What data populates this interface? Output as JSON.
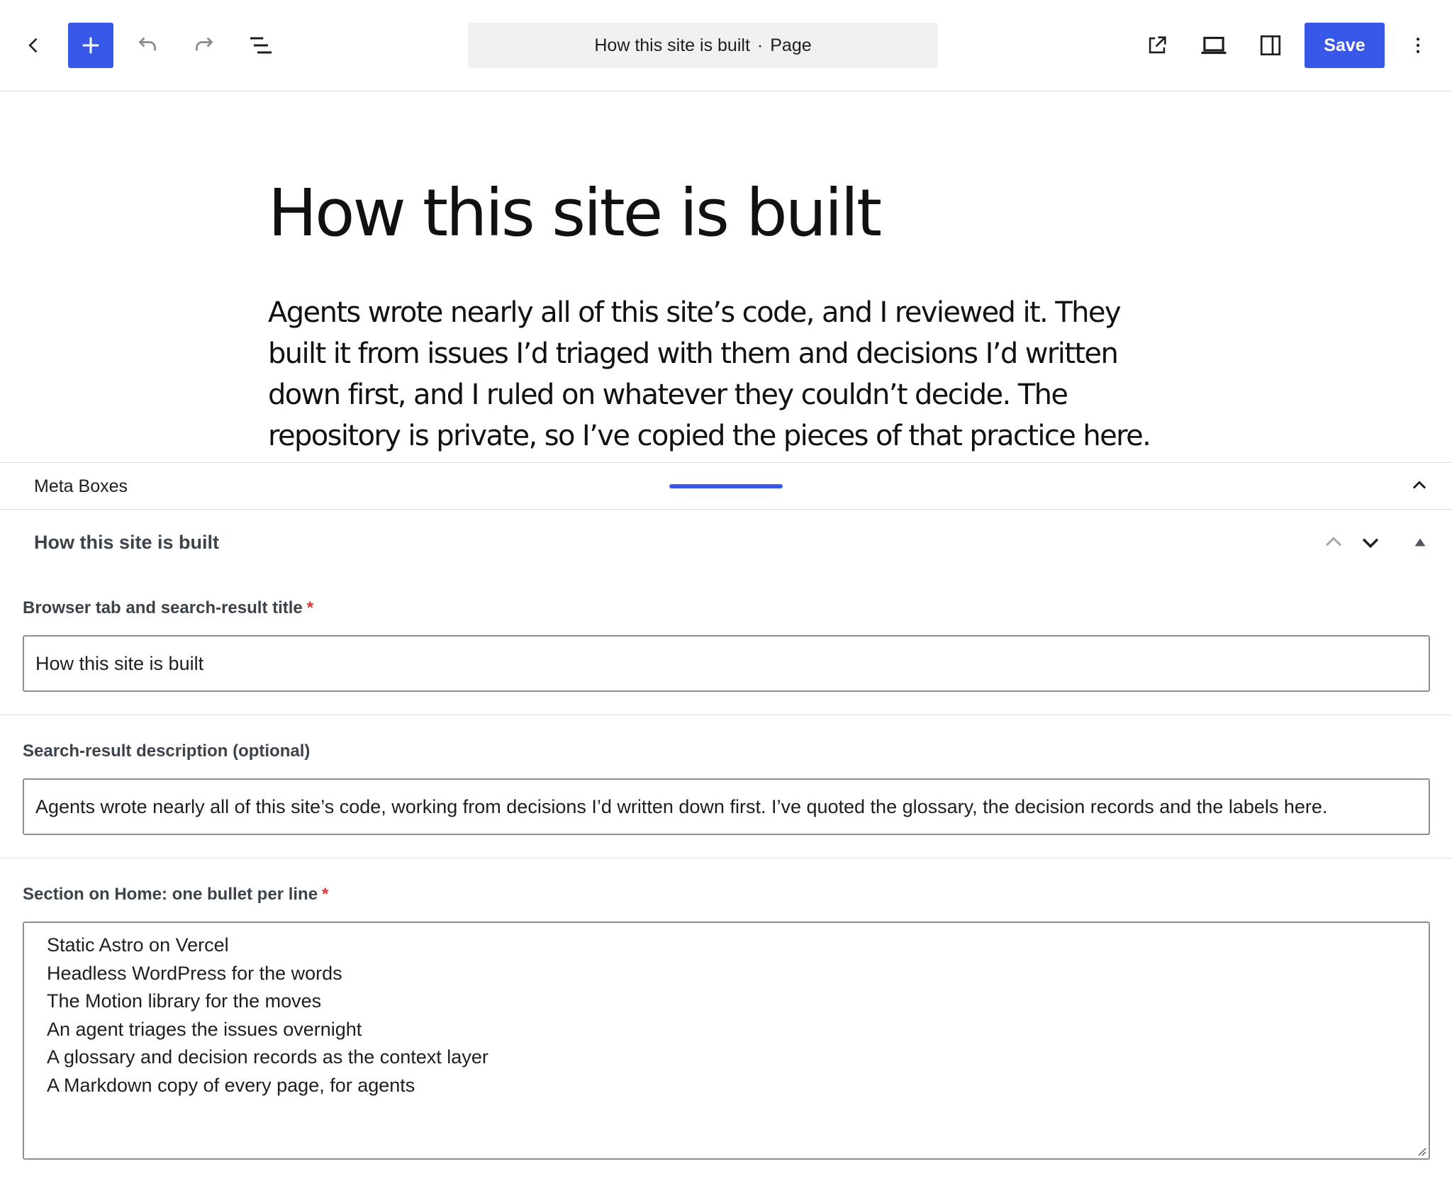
{
  "toolbar": {
    "back_icon": "chevron-left-icon",
    "add_icon": "plus-icon",
    "undo_icon": "undo-icon",
    "redo_icon": "redo-icon",
    "list_view_icon": "list-view-icon",
    "document_title": "How this site is built",
    "document_separator": "·",
    "document_type": "Page",
    "view_icon": "external-link-icon",
    "device_icon": "laptop-icon",
    "settings_icon": "sidebar-icon",
    "save_label": "Save",
    "options_icon": "more-vertical-icon"
  },
  "canvas": {
    "title": "How this site is built",
    "paragraph": "Agents wrote nearly all of this site’s code, and I reviewed it. They built it from issues I’d triaged with them and decisions I’d written down first, and I ruled on whatever they couldn’t decide. The repository is private, so I’ve copied the pieces of that practice here."
  },
  "meta_boxes": {
    "header_label": "Meta Boxes",
    "panel_title": "How this site is built",
    "fields": {
      "seo_title": {
        "label": "Browser tab and search-result title",
        "required_mark": "*",
        "value": "How this site is built"
      },
      "seo_description": {
        "label": "Search-result description (optional)",
        "value": "Agents wrote nearly all of this site’s code, working from decisions I’d written down first. I’ve quoted the glossary, the decision records and the labels here."
      },
      "home_section": {
        "label": "Section on Home: one bullet per line",
        "required_mark": "*",
        "lines": [
          "Static Astro on Vercel",
          "Headless WordPress for the words",
          "The Motion library for the moves",
          "An agent triages the issues overnight",
          "A glossary and decision records as the context layer",
          "A Markdown copy of every page, for agents"
        ]
      }
    }
  },
  "colors": {
    "accent": "#3858e9",
    "required": "#d63638",
    "border": "#8c8f94"
  }
}
